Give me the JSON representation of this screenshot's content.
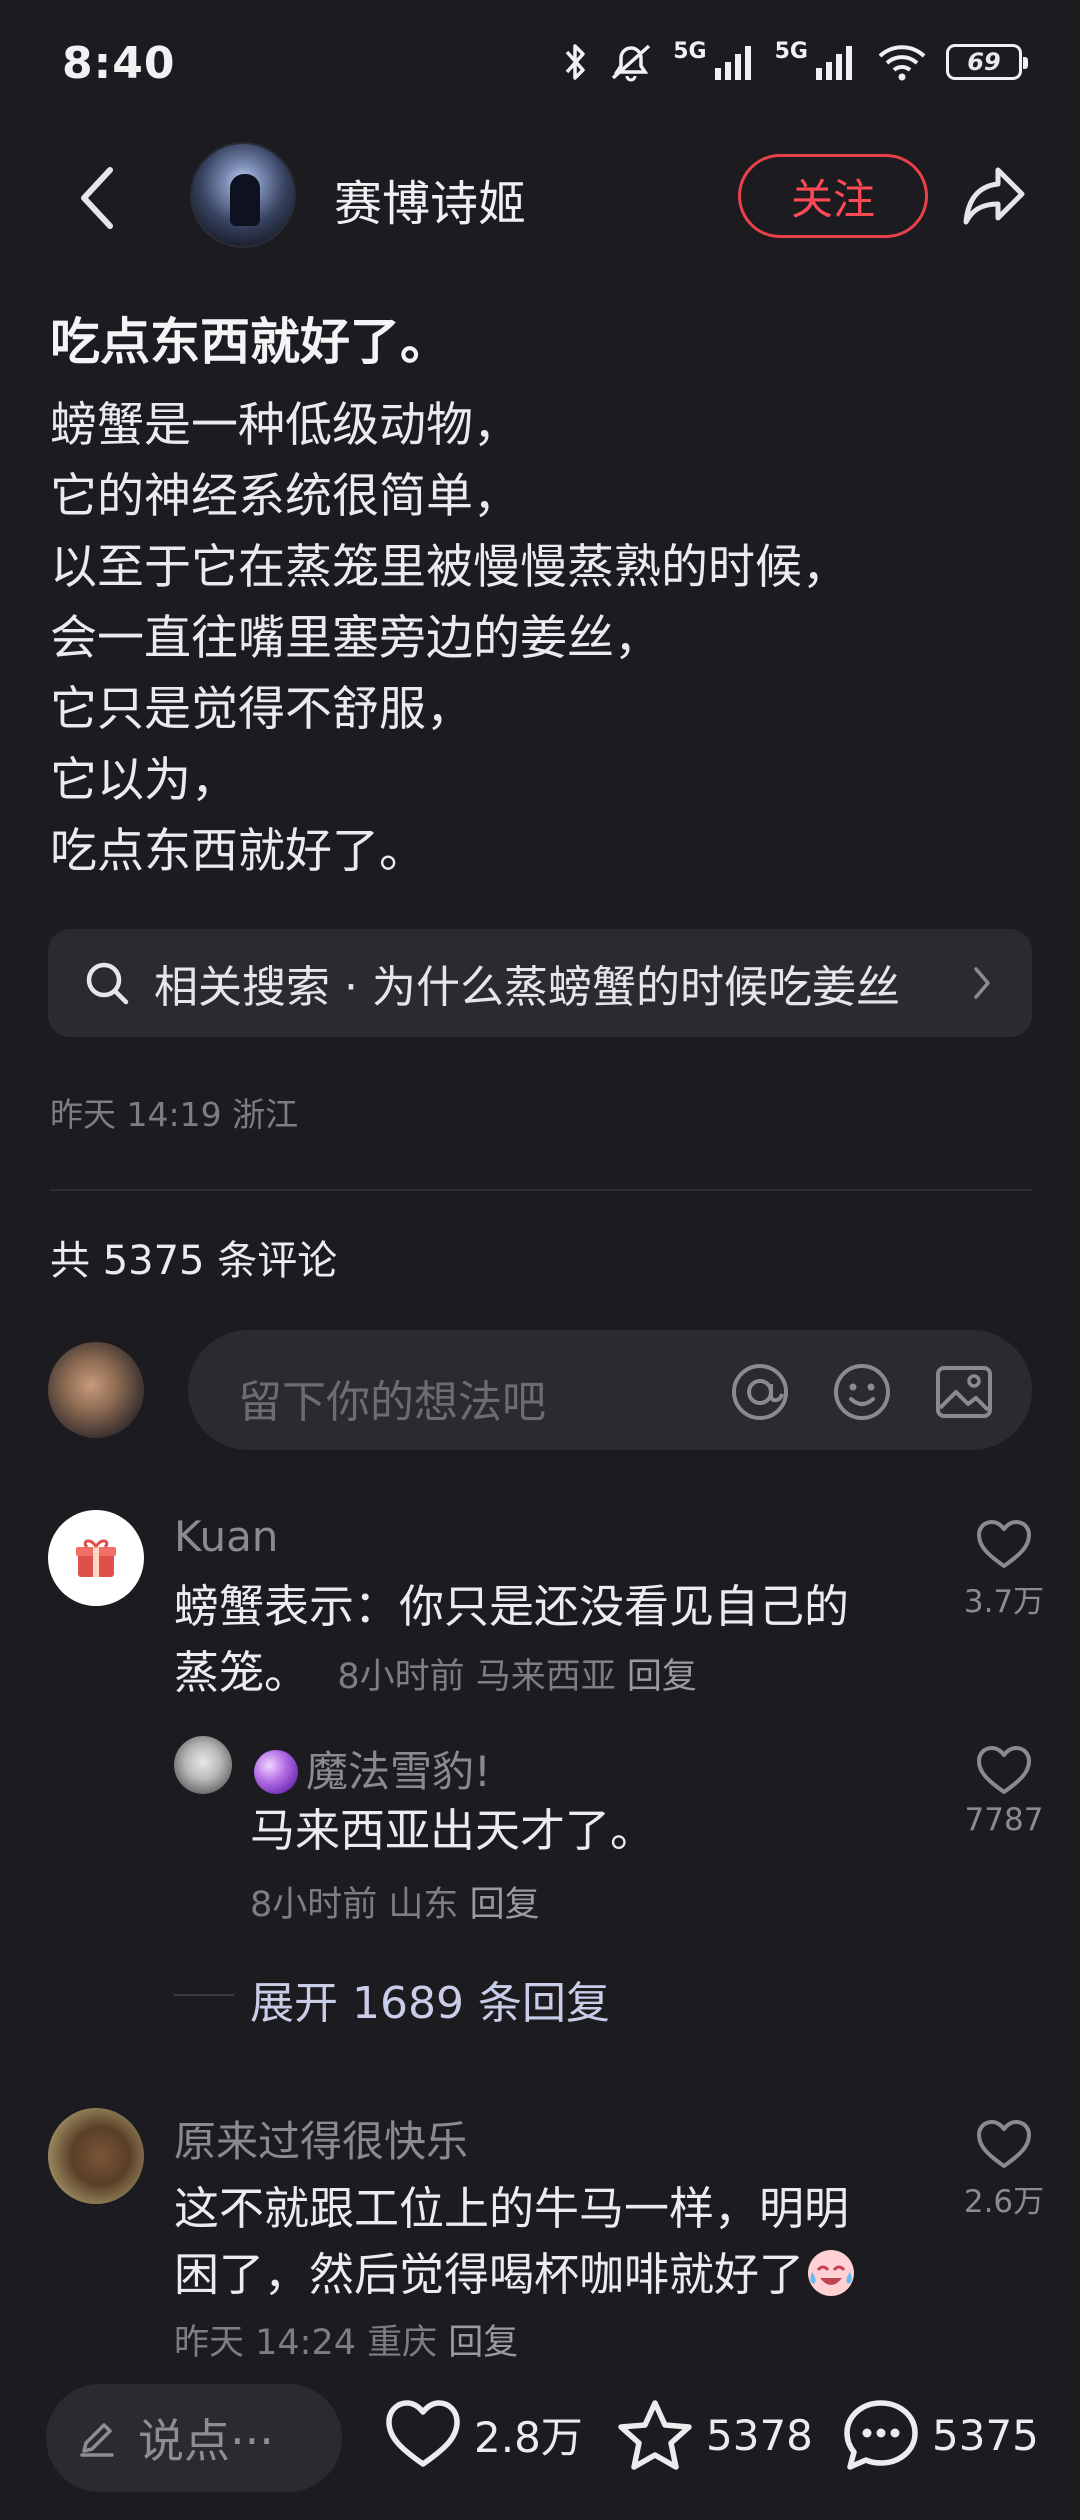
{
  "status_bar": {
    "time": "8:40",
    "network_1": "5G",
    "network_2": "5G",
    "battery": "69"
  },
  "header": {
    "username": "赛博诗姬",
    "follow_label": "关注"
  },
  "post": {
    "title": "吃点东西就好了。",
    "lines": [
      "螃蟹是一种低级动物，",
      "它的神经系统很简单，",
      "以至于它在蒸笼里被慢慢蒸熟的时候，",
      "会一直往嘴里塞旁边的姜丝，",
      "它只是觉得不舒服，",
      "它以为，",
      "吃点东西就好了。"
    ],
    "related_search": "相关搜索 · 为什么蒸螃蟹的时候吃姜丝",
    "meta": "昨天 14:19 浙江"
  },
  "comments_header": "共 5375 条评论",
  "comment_input": {
    "placeholder": "留下你的想法吧"
  },
  "comments": [
    {
      "name": "Kuan",
      "text_line1": "螃蟹表示：你只是还没看见自己的",
      "text_line2": "蒸笼。",
      "time": "8小时前",
      "location": "马来西亚",
      "reply_label": "回复",
      "likes": "3.7万"
    },
    {
      "name": "魔法雪豹!",
      "text": "马来西亚出天才了。",
      "time": "8小时前",
      "location": "山东",
      "reply_label": "回复",
      "likes": "7787"
    },
    {
      "name": "原来过得很快乐",
      "text_line1": "这不就跟工位上的牛马一样，明明",
      "text_line2": "困了，然后觉得喝杯咖啡就好了",
      "time": "昨天 14:24",
      "location": "重庆",
      "reply_label": "回复",
      "likes": "2.6万"
    }
  ],
  "expand_replies": "展开 1689 条回复",
  "bottom_bar": {
    "say_placeholder": "说点···",
    "likes": "2.8万",
    "favorites": "5378",
    "comments": "5375"
  },
  "colors": {
    "background": "#1c1c20",
    "accent_red": "#ff4a55",
    "surface": "#2a2a30",
    "muted_text": "#7d7d86"
  },
  "icons": [
    "back-arrow-icon",
    "share-icon",
    "search-icon",
    "chevron-right-icon",
    "at-icon",
    "emoji-icon",
    "image-icon",
    "heart-icon",
    "star-icon",
    "comment-bubble-icon",
    "pencil-icon",
    "gift-icon",
    "bluetooth-icon",
    "mute-icon",
    "wifi-icon"
  ]
}
